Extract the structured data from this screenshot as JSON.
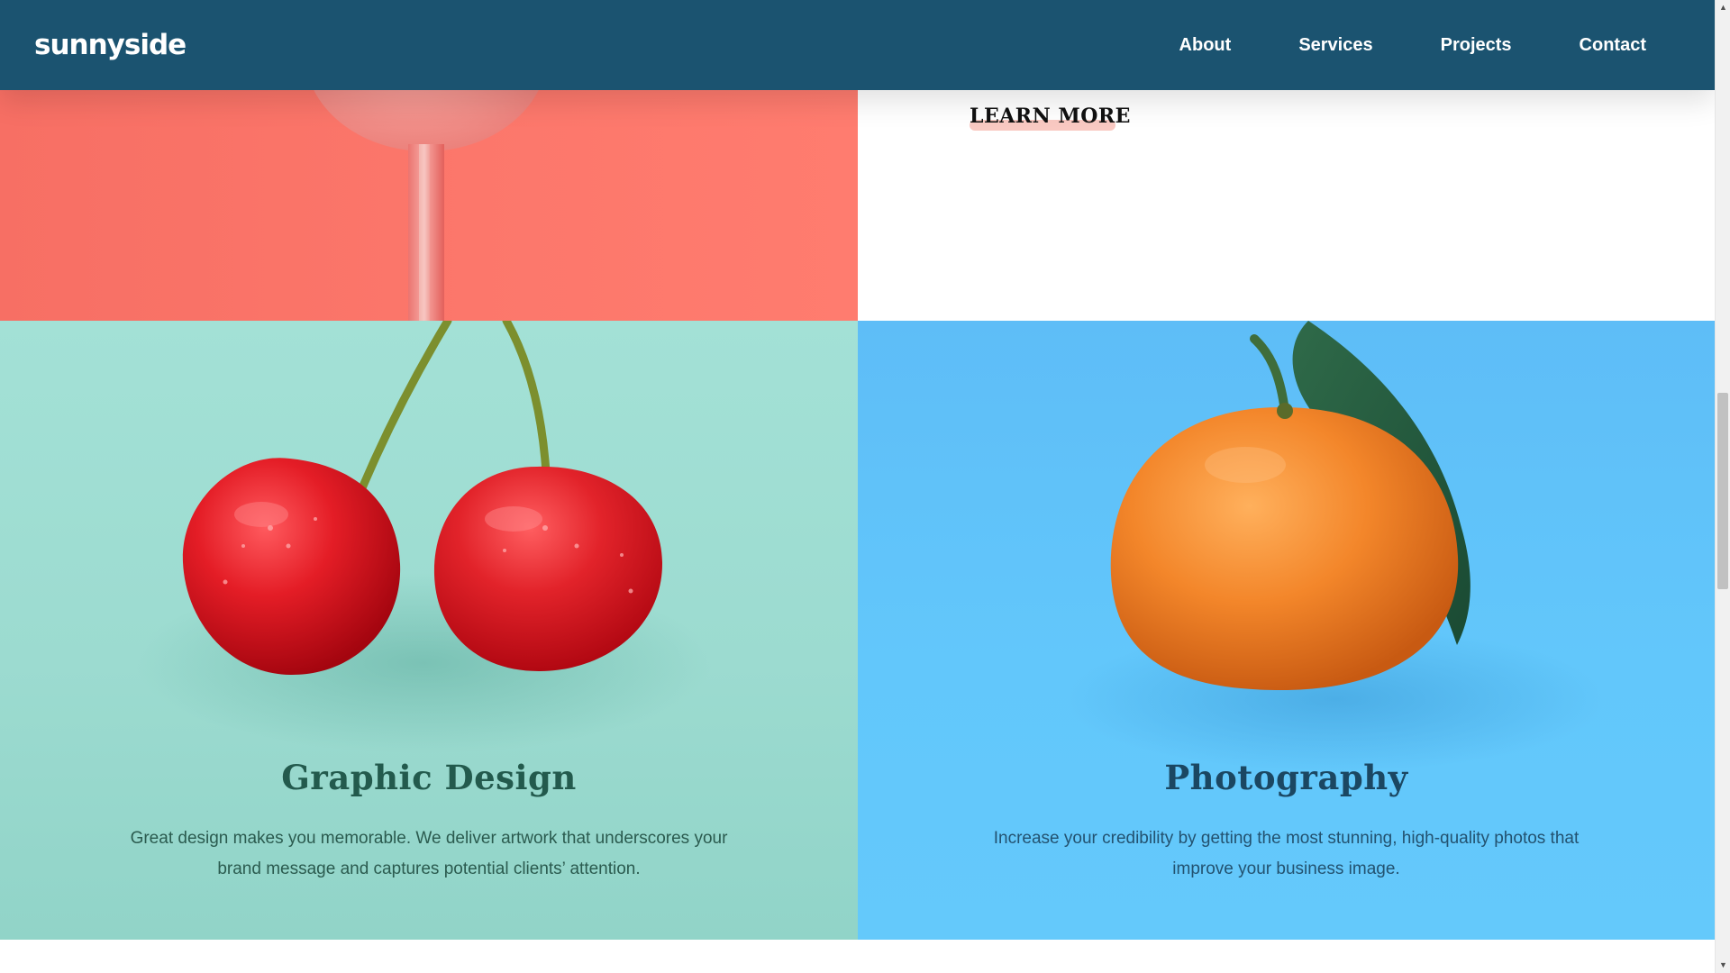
{
  "header": {
    "logo": "sunnyside",
    "nav": [
      "About",
      "Services",
      "Projects",
      "Contact"
    ]
  },
  "hero": {
    "cta_label": "LEARN MORE"
  },
  "services": [
    {
      "title": "Graphic Design",
      "description": "Great design makes you memorable. We deliver artwork that underscores your brand message and captures potential clients’ attention."
    },
    {
      "title": "Photography",
      "description": "Increase your credibility by getting the most stunning, high-quality photos that improve your business image."
    }
  ],
  "colors": {
    "header_bg": "#1b5370",
    "hero_coral": "#fc776b",
    "graphic_bg": "#9cdbd0",
    "photo_bg": "#62c7fb",
    "cherry": "#d91b22",
    "orange": "#f38a2c",
    "cta_underline": "#f9c9c2"
  },
  "icons": {
    "scroll_up": "▲",
    "scroll_down": "▼"
  }
}
